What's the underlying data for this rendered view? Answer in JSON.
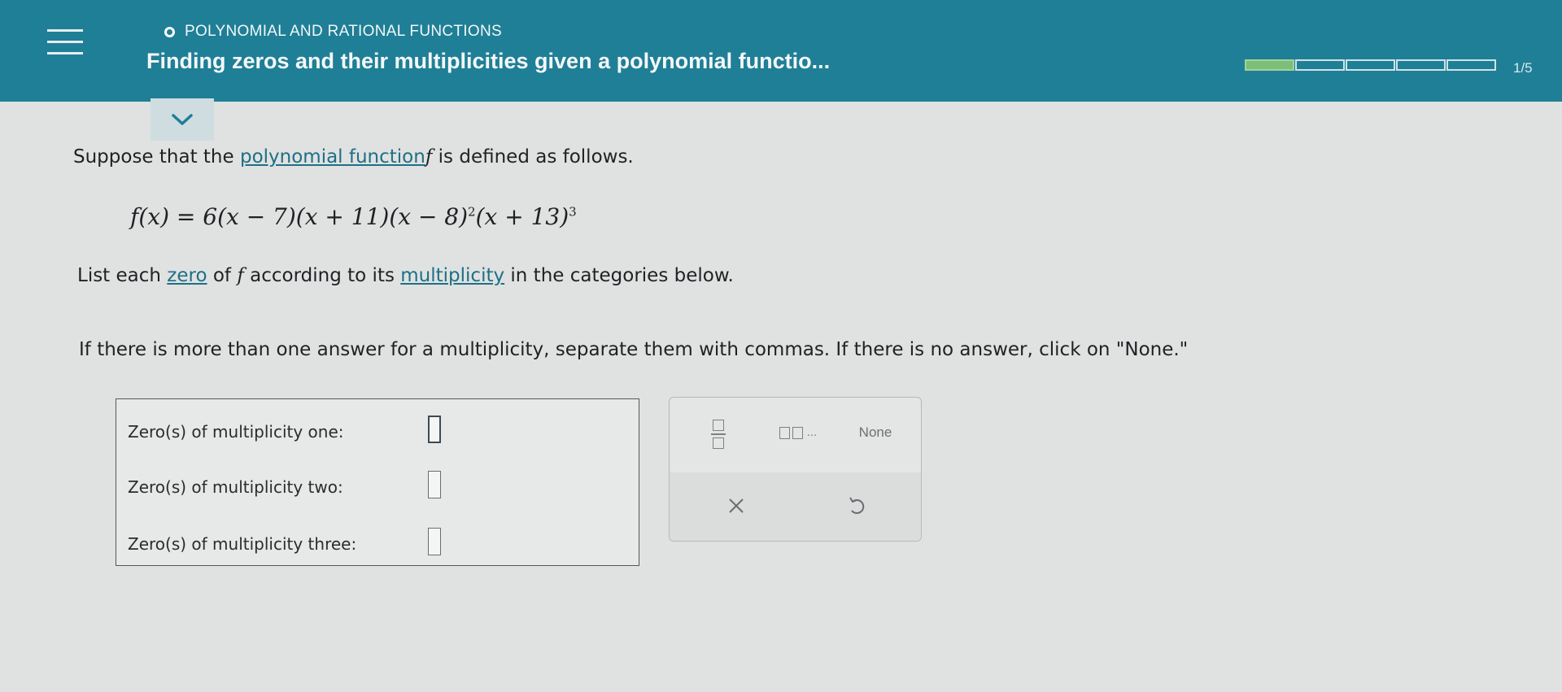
{
  "header": {
    "topic": "POLYNOMIAL AND RATIONAL FUNCTIONS",
    "title": "Finding zeros and their multiplicities given a polynomial functio...",
    "progress_text": "1/5",
    "progress": {
      "completed": 1,
      "total": 5
    },
    "colors": {
      "bar": "#1f7f96",
      "progress_fill": "#7dbe78"
    }
  },
  "icons": {
    "menu": "hamburger-menu-icon",
    "collapse": "chevron-down-icon",
    "clear": "times-icon",
    "undo": "undo-icon"
  },
  "problem": {
    "intro_before": "Suppose that the ",
    "intro_term": "polynomial function",
    "intro_var": "f",
    "intro_after": " is defined as follows.",
    "equation": {
      "lhs": "f(x) = 6(x − 7)(x + 11)(x − 8)",
      "exp1": "2",
      "mid": "(x + 13)",
      "exp2": "3"
    },
    "list_prefix": "List each ",
    "list_term1": "zero",
    "list_of": " of ",
    "list_var": "f",
    "list_according": " according to its ",
    "list_term2": "multiplicity",
    "list_suffix": " in the categories below.",
    "instruction": "If there is more than one answer for a multiplicity, separate them with commas. If there is no answer, click on \"None.\""
  },
  "answers": {
    "rows": [
      {
        "label": "Zero(s) of multiplicity one:",
        "value": ""
      },
      {
        "label": "Zero(s) of multiplicity two:",
        "value": ""
      },
      {
        "label": "Zero(s) of multiplicity three:",
        "value": ""
      }
    ]
  },
  "keypad": {
    "list_dots": "...",
    "none_label": "None"
  }
}
